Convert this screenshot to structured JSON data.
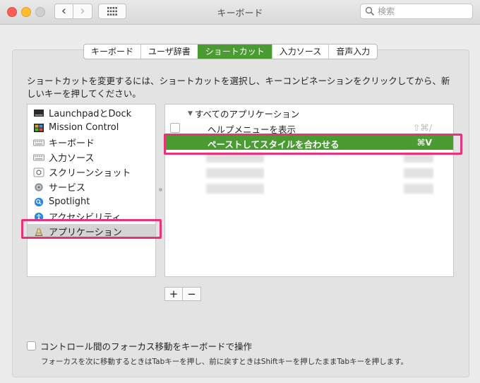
{
  "window": {
    "title": "キーボード",
    "search_placeholder": "検索",
    "back_glyph": "‹",
    "forward_glyph": "›"
  },
  "tabs": [
    {
      "label": "キーボード",
      "active": false
    },
    {
      "label": "ユーザ辞書",
      "active": false
    },
    {
      "label": "ショートカット",
      "active": true
    },
    {
      "label": "入力ソース",
      "active": false
    },
    {
      "label": "音声入力",
      "active": false
    }
  ],
  "instructions": "ショートカットを変更するには、ショートカットを選択し、キーコンビネーションをクリックしてから、新しいキーを押してください。",
  "categories": [
    {
      "label": "LaunchpadとDock",
      "icon": "launchpad-dock-icon"
    },
    {
      "label": "Mission Control",
      "icon": "mission-control-icon"
    },
    {
      "label": "キーボード",
      "icon": "keyboard-icon"
    },
    {
      "label": "入力ソース",
      "icon": "input-source-icon"
    },
    {
      "label": "スクリーンショット",
      "icon": "screenshot-icon"
    },
    {
      "label": "サービス",
      "icon": "gear-icon"
    },
    {
      "label": "Spotlight",
      "icon": "spotlight-icon"
    },
    {
      "label": "アクセシビリティ",
      "icon": "accessibility-icon"
    },
    {
      "label": "アプリケーション",
      "icon": "app-store-icon",
      "selected": true
    }
  ],
  "shortcuts": {
    "group_label": "すべてのアプリケーション",
    "items": [
      {
        "label": "ヘルプメニューを表示",
        "key": "⇧⌘/",
        "checked": false,
        "selected": false
      },
      {
        "label": "ペーストしてスタイルを合わせる",
        "key": "⌘V",
        "selected": true
      }
    ]
  },
  "buttons": {
    "add": "+",
    "remove": "−"
  },
  "footer": {
    "checkbox_label": "コントロール間のフォーカス移動をキーボードで操作",
    "checked": false,
    "note": "フォーカスを次に移動するときはTabキーを押し、前に戻すときはShiftキーを押したままTabキーを押します。"
  },
  "colors": {
    "accent": "#4b9b33",
    "highlight": "#e8337a"
  }
}
